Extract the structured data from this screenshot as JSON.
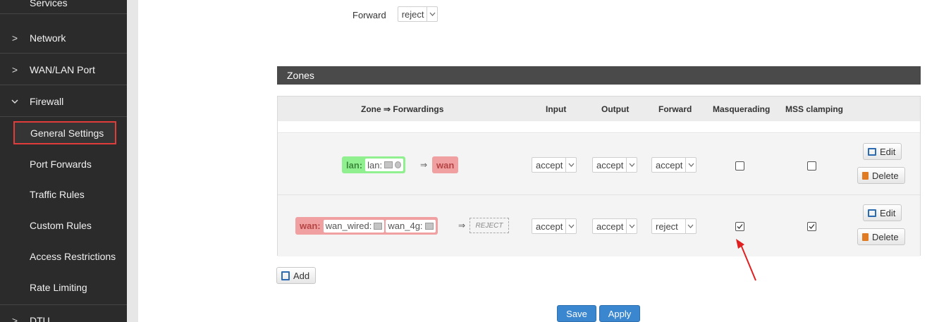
{
  "sidebar": {
    "services_label": "Services",
    "items": [
      {
        "label": "Network",
        "chevron": ">"
      },
      {
        "label": "WAN/LAN Port",
        "chevron": ">"
      },
      {
        "label": "Firewall",
        "chevron": "v"
      }
    ],
    "firewall_sub": [
      {
        "label": "General Settings",
        "active": true
      },
      {
        "label": "Port Forwards"
      },
      {
        "label": "Traffic Rules"
      },
      {
        "label": "Custom Rules"
      },
      {
        "label": "Access Restrictions"
      },
      {
        "label": "Rate Limiting"
      }
    ],
    "dtu": {
      "label": "DTU",
      "chevron": ">"
    }
  },
  "defaults": {
    "forward_label": "Forward",
    "forward_value": "reject"
  },
  "zones": {
    "title": "Zones",
    "columns": [
      "Zone ⇒ Forwardings",
      "Input",
      "Output",
      "Forward",
      "Masquerading",
      "MSS clamping"
    ],
    "rows": [
      {
        "zone": "lan:",
        "networks": [
          "lan:"
        ],
        "arrow": "⇒",
        "dest": "wan",
        "input": "accept",
        "output": "accept",
        "forward": "accept",
        "masquerading": false,
        "mss_clamping": false
      },
      {
        "zone": "wan:",
        "networks": [
          "wan_wired:",
          "wan_4g:"
        ],
        "arrow": "⇒",
        "dest": "REJECT",
        "input": "accept",
        "output": "accept",
        "forward": "reject",
        "masquerading": true,
        "mss_clamping": true
      }
    ],
    "edit_label": "Edit",
    "delete_label": "Delete",
    "add_label": "Add"
  },
  "footer": {
    "save_label": "Save",
    "apply_label": "Apply"
  },
  "colors": {
    "lan_zone": "#90f090",
    "wan_zone": "#f0a0a0",
    "primary": "#3a86cf",
    "highlight": "#e03c3c"
  }
}
